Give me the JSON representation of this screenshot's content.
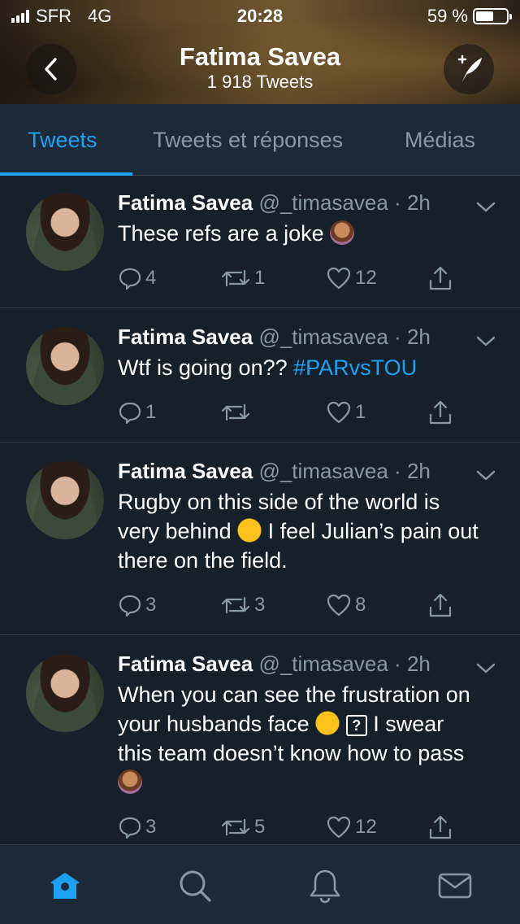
{
  "status_bar": {
    "carrier": "SFR",
    "network": "4G",
    "time": "20:28",
    "battery_text": "59 %",
    "battery_level": 0.59
  },
  "profile": {
    "name": "Fatima Savea",
    "tweet_count": "1 918 Tweets"
  },
  "tabs": [
    {
      "label": "Tweets",
      "active": true
    },
    {
      "label": "Tweets et réponses",
      "active": false
    },
    {
      "label": "Médias",
      "active": false
    }
  ],
  "tweets": [
    {
      "name": "Fatima Savea",
      "handle": "@_timasavea",
      "separator": "·",
      "time": "2h",
      "text": "These refs are a joke",
      "replies": "4",
      "retweets": "1",
      "likes": "12"
    },
    {
      "name": "Fatima Savea",
      "handle": "@_timasavea",
      "separator": "·",
      "time": "2h",
      "text": "Wtf is going on??",
      "hashtag": "#PARvsTOU",
      "replies": "1",
      "retweets": "",
      "likes": "1"
    },
    {
      "name": "Fatima Savea",
      "handle": "@_timasavea",
      "separator": "·",
      "time": "2h",
      "text_a": "Rugby on this side of the world is very behind",
      "text_b": "I feel Julian’s pain out there on the field.",
      "replies": "3",
      "retweets": "3",
      "likes": "8"
    },
    {
      "name": "Fatima Savea",
      "handle": "@_timasavea",
      "separator": "·",
      "time": "2h",
      "text_a": "When you can see the frustration on your husbands face",
      "qbox": "?",
      "text_b": "I swear this team doesn’t know how to pass",
      "replies": "3",
      "retweets": "5",
      "likes": "12"
    }
  ],
  "colors": {
    "background": "#15202b",
    "panel": "#1c2938",
    "accent": "#1da1f2",
    "muted": "#8899a6"
  },
  "icons": {
    "header": [
      "back-arrow-icon",
      "compose-tweet-icon"
    ],
    "actions": [
      "reply-icon",
      "retweet-icon",
      "like-icon",
      "share-icon",
      "caret-down-icon"
    ],
    "bottom_nav": [
      "home-icon",
      "search-icon",
      "notifications-icon",
      "messages-icon"
    ]
  }
}
